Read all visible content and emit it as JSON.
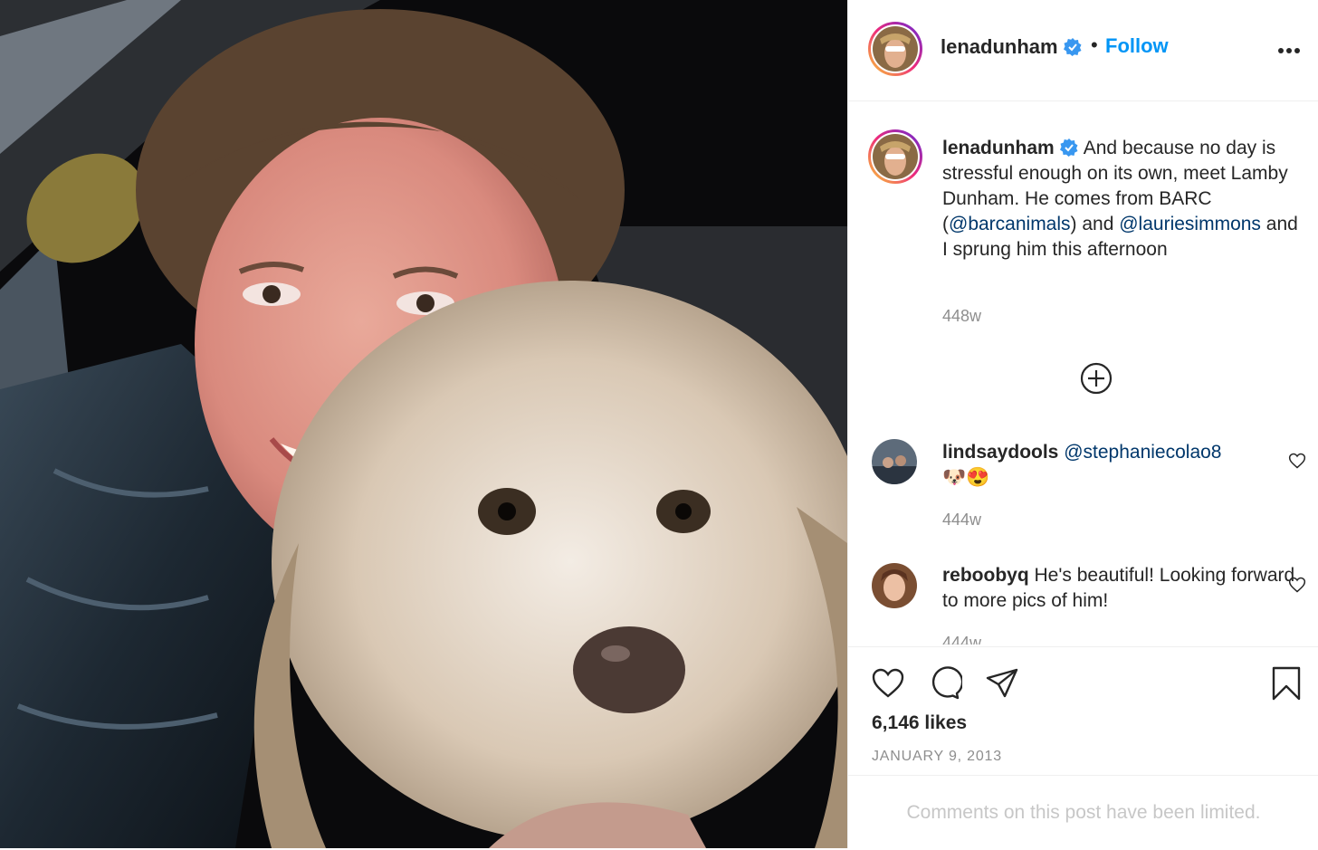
{
  "post": {
    "username": "lenadunham",
    "follow_label": "Follow",
    "separator": "•",
    "more_label": "•••"
  },
  "caption": {
    "username": "lenadunham",
    "text_part1": "And because no day is stressful enough on its own, meet Lamby Dunham. He comes from BARC (",
    "mention1": "@barcanimals",
    "text_part2": ") and ",
    "mention2": "@lauriesimmons",
    "text_part3": " and I sprung him this afternoon",
    "age": "448w"
  },
  "comments": [
    {
      "username": "lindsaydools",
      "mention": "@stephaniecolao8",
      "text": "🐶😍",
      "age": "444w"
    },
    {
      "username": "reboobyq",
      "text": "He's beautiful! Looking forward to more pics of him!",
      "age": "444w"
    }
  ],
  "stats": {
    "likes": "6,146 likes",
    "date": "JANUARY 9, 2013"
  },
  "footer": {
    "limited_text": "Comments on this post have been limited."
  },
  "colors": {
    "link_blue": "#0095f6",
    "mention_blue": "#00376b",
    "muted_gray": "#8e8e8e",
    "text": "#262626"
  },
  "icons": [
    "verified-badge-icon",
    "more-options-icon",
    "load-more-comments-icon",
    "like-heart-icon",
    "comment-bubble-icon",
    "share-send-icon",
    "save-bookmark-icon"
  ]
}
